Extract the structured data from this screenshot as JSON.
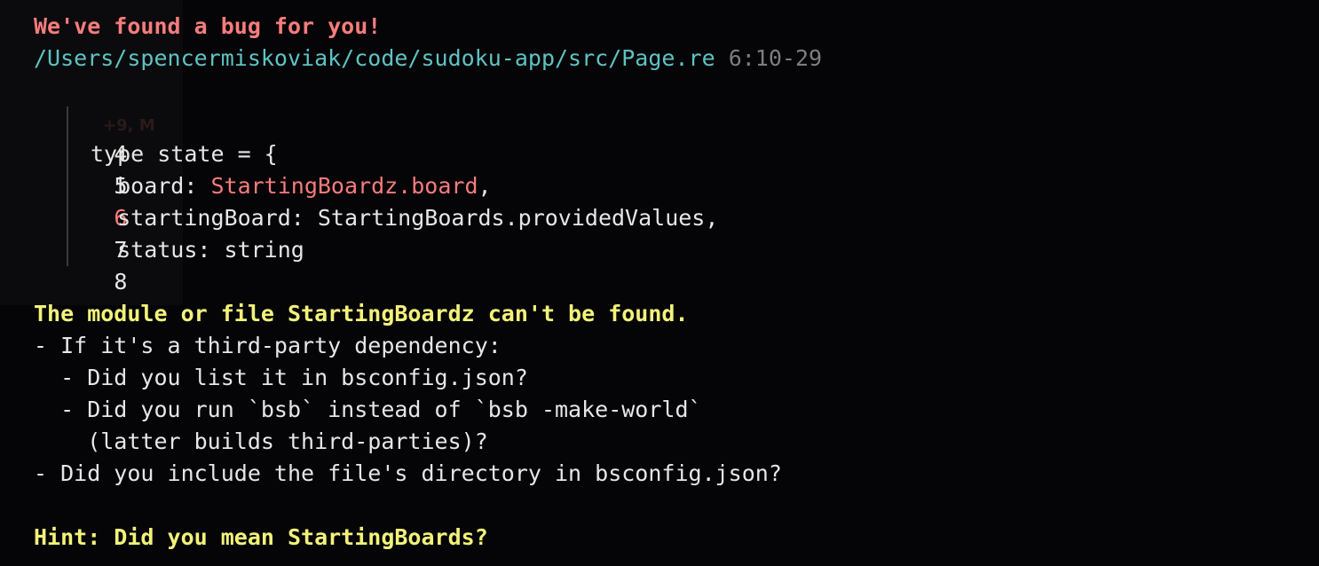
{
  "header": {
    "title": "We've found a bug for you!",
    "path": "/Users/spencermiskoviak/code/sudoku-app/src/Page.re",
    "location": "6:10-29"
  },
  "code": {
    "ghost_text": "+9, M",
    "lines": [
      {
        "num": "4",
        "pre": "",
        "err": "",
        "post": ""
      },
      {
        "num": "5",
        "pre": "type state = {",
        "err": "",
        "post": ""
      },
      {
        "num": "6",
        "pre": "  board: ",
        "err": "StartingBoardz.board",
        "post": ","
      },
      {
        "num": "7",
        "pre": "  startingBoard: StartingBoards.providedValues,",
        "err": "",
        "post": ""
      },
      {
        "num": "8",
        "pre": "  status: string",
        "err": "",
        "post": ""
      }
    ]
  },
  "message": {
    "title": "The module or file StartingBoardz can't be found.",
    "items": [
      "- If it's a third-party dependency:",
      "  - Did you list it in bsconfig.json?",
      "  - Did you run `bsb` instead of `bsb -make-world`",
      "    (latter builds third-parties)?",
      "- Did you include the file's directory in bsconfig.json?"
    ]
  },
  "hint": "Hint: Did you mean StartingBoards?",
  "colors": {
    "background": "#050508",
    "error": "#f77c7c",
    "path": "#5ec3c3",
    "warning": "#f2f27a",
    "text": "#e6e6e6"
  }
}
